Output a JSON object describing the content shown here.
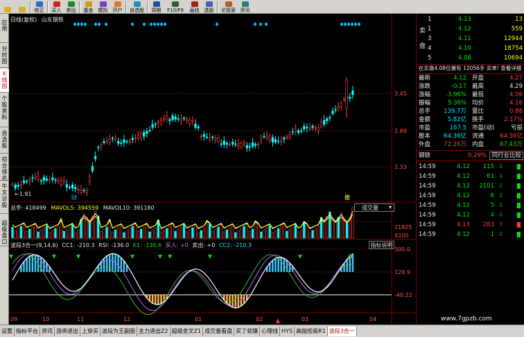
{
  "toolbar": {
    "buttons": [
      "修正",
      "买入",
      "卖出",
      "基金",
      "模拟",
      "开户",
      "自选股",
      "周期",
      "F10/F9",
      "画线",
      "选股",
      "论管家",
      "资讯"
    ]
  },
  "left_tabs": [
    "应用",
    "分时图",
    "K线图",
    "个股资料",
    "自选股",
    "综合排名",
    "牛叉诊股",
    "超级盘口"
  ],
  "chart": {
    "period": "日线(复权)",
    "stock_name": "山东钢铁",
    "price_ticks": [
      "3.45",
      "2.89",
      "2.33"
    ],
    "low_marker": "←1.91",
    "peak_marker": "撤",
    "fin_marker": "财",
    "volume": {
      "total_label": "总手: 418499",
      "mavol5_label": "MAVOL5: 394559",
      "mavol10_label": "MAVOL10: 391180",
      "selector": "成交量",
      "ticks": [
        "21825",
        "X100"
      ]
    },
    "indicator": {
      "name": "波段3合一",
      "params": "(9,14,6)",
      "cc1_label": "CC1: -210.3",
      "rsi_label": "RSI: -136.0",
      "k1_label": "K1: -136.6",
      "buy_label": "买入: +0",
      "sell_label": "卖出: +0",
      "cc2_label": "CC2: -210.3",
      "help_button": "指标说明",
      "ticks": [
        "300.0",
        "129.9",
        "-40.22"
      ]
    },
    "x_axis": [
      "09",
      "10",
      "11",
      "12",
      "01",
      "02",
      "03",
      "04"
    ],
    "colors": {
      "up": "#ff3c3c",
      "down": "#00ffff",
      "accent": "#ffff00",
      "cyan": "#00ffff"
    }
  },
  "right_panel": {
    "sell_side_label": "卖盘",
    "sell_orders": [
      {
        "level": "1",
        "price": "4.13",
        "volume": "13"
      },
      {
        "level": "1",
        "price": "4.12",
        "volume": "559"
      },
      {
        "level": "3",
        "price": "4.11",
        "volume": "12944"
      },
      {
        "level": "4",
        "price": "4.10",
        "volume": "18754"
      },
      {
        "level": "5",
        "price": "4.08",
        "volume": "10694"
      }
    ],
    "order_note": "在买盘4.08位置有 12056手 买单! 查看详细",
    "stats": [
      {
        "l1": "最新",
        "v1": "4.12",
        "l2": "开盘",
        "v2": "4.27"
      },
      {
        "l1": "涨跌",
        "v1": "-0.17",
        "l2": "最高",
        "v2": "4.29"
      },
      {
        "l1": "涨幅",
        "v1": "-3.96%",
        "l2": "最低",
        "v2": "4.06"
      },
      {
        "l1": "振幅",
        "v1": "5.36%",
        "l2": "均价",
        "v2": "4.16"
      },
      {
        "l1": "总手",
        "v1": "139.7万",
        "l2": "量比",
        "v2": "0.88"
      },
      {
        "l1": "金额",
        "v1": "5.82亿",
        "l2": "换手",
        "v2": "2.17%"
      },
      {
        "l1": "市盈",
        "v1": "167.5",
        "l2": "市盈(动)",
        "v2": "亏损"
      },
      {
        "l1": "股本",
        "v1": "64.36亿",
        "l2": "流通",
        "v2": "64.36亿"
      },
      {
        "l1": "外盘",
        "v1": "72.26万",
        "l2": "内盘",
        "v2": "67.43万"
      }
    ],
    "sector": {
      "name": "钢铁",
      "pct": "0.29%",
      "button": "同行业比较"
    },
    "ticks": [
      {
        "time": "14:59",
        "price": "4.12",
        "vol": "115"
      },
      {
        "time": "14:59",
        "price": "4.12",
        "vol": "61"
      },
      {
        "time": "14:59",
        "price": "4.12",
        "vol": "2101"
      },
      {
        "time": "14:59",
        "price": "4.12",
        "vol": "6"
      },
      {
        "time": "14:59",
        "price": "4.12",
        "vol": "5"
      },
      {
        "time": "14:59",
        "price": "4.12",
        "vol": "4"
      },
      {
        "time": "14:59",
        "price": "4.13",
        "vol": "283"
      },
      {
        "time": "14:59",
        "price": "4.12",
        "vol": "1"
      }
    ]
  },
  "bottom_tabs": [
    "设置",
    "指标平台",
    "资讯",
    "游资进出",
    "上穿买",
    "波段为王副图",
    "主力进出Z2",
    "超级金叉Z1",
    "成交量看盘",
    "买了就赚",
    "心理线",
    "HYS",
    "高抛低吸R1",
    "波段3合一"
  ],
  "watermark": "www.7gpzb.com"
}
